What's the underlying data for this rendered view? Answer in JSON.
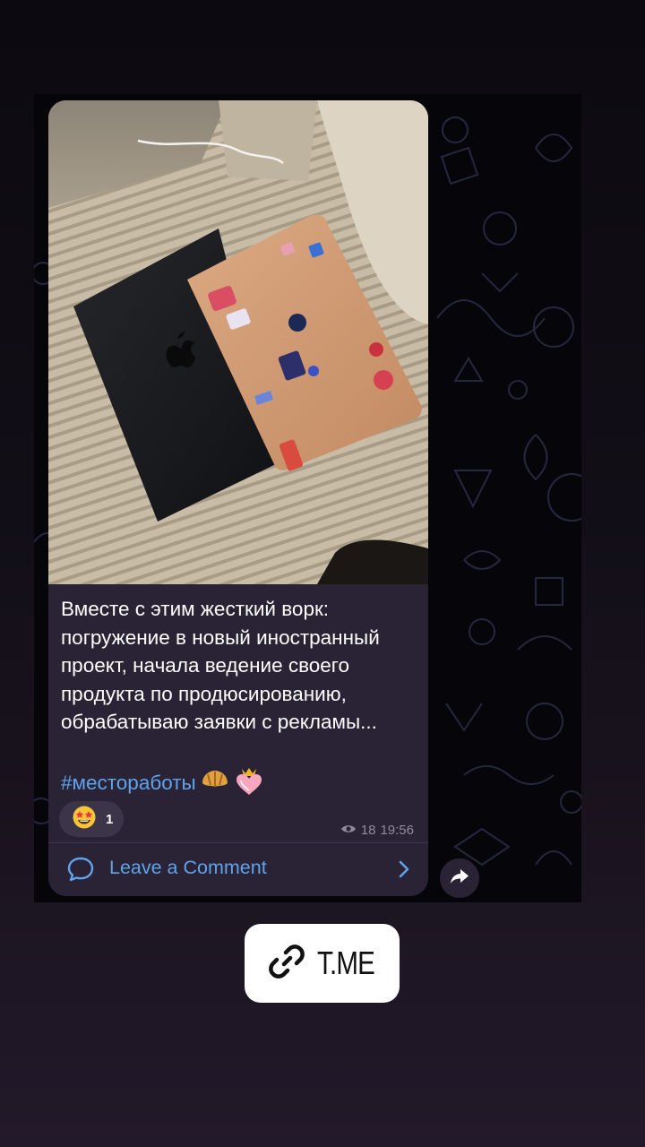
{
  "post": {
    "text_lines": [
      "Вместе с этим жесткий ворк:",
      "погружение в новый иностранный",
      "проект, начала ведение своего",
      "продукта по продюсированию,",
      "обрабатываю заявки с рекламы..."
    ],
    "hashtag": "#месторaботы",
    "hashtag_emojis": [
      "croissant-emoji",
      "heart-with-crown-emoji"
    ],
    "reaction": {
      "emoji": "star-struck-emoji",
      "count": "1"
    },
    "views": "18",
    "time": "19:56"
  },
  "comments": {
    "label": "Leave a Comment"
  },
  "link_sticker": {
    "label": "T.ME",
    "icon": "link-icon"
  },
  "colors": {
    "accent": "#5fa3ec",
    "bubble": "#2a2335",
    "chat_background": "#06060a"
  }
}
